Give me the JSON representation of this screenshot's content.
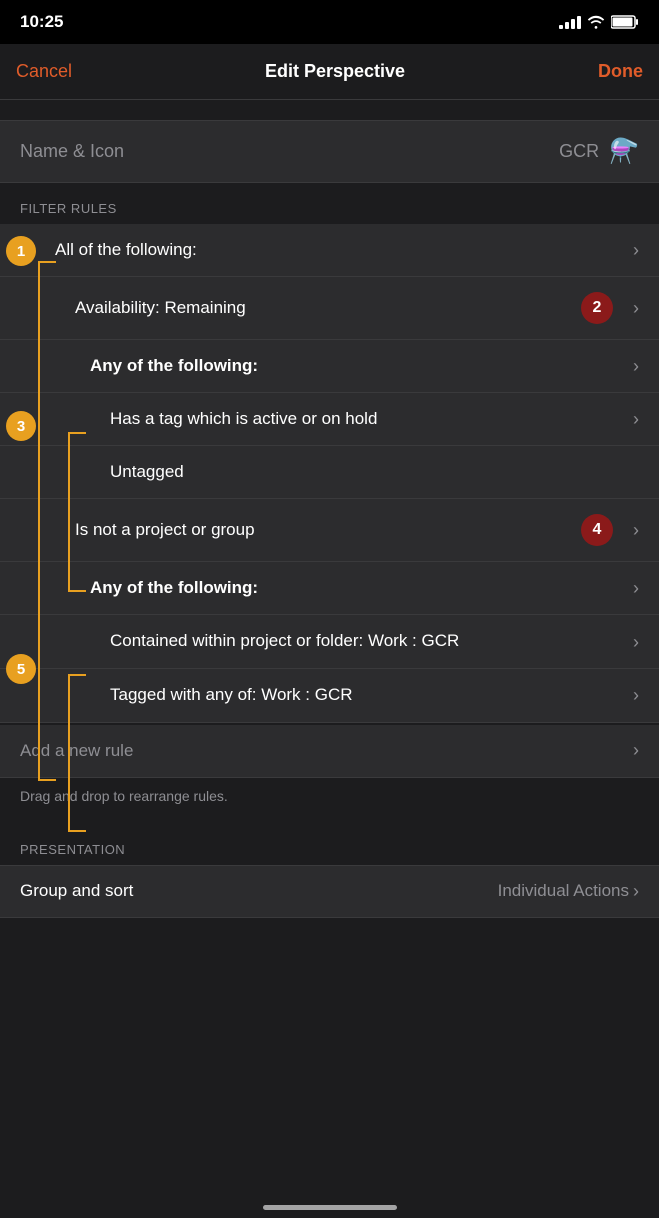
{
  "statusBar": {
    "time": "10:25",
    "timeIcon": "location-icon"
  },
  "navBar": {
    "cancelLabel": "Cancel",
    "title": "Edit Perspective",
    "doneLabel": "Done"
  },
  "nameSection": {
    "label": "Name & Icon",
    "value": "GCR",
    "iconLabel": "flask-icon"
  },
  "filterSection": {
    "header": "FILTER RULES",
    "rules": [
      {
        "id": "rule-1",
        "text": "All of the following:",
        "indent": 0,
        "bold": false,
        "hasChevron": true,
        "badge": null,
        "annotation": "1"
      },
      {
        "id": "rule-2",
        "text": "Availability: Remaining",
        "indent": 1,
        "bold": false,
        "hasChevron": true,
        "badge": "2",
        "annotation": null
      },
      {
        "id": "rule-3",
        "text": "Any of the following:",
        "indent": 1,
        "bold": true,
        "hasChevron": true,
        "badge": null,
        "annotation": null
      },
      {
        "id": "rule-4",
        "text": "Has a tag which is active or on hold",
        "indent": 2,
        "bold": false,
        "hasChevron": true,
        "badge": null,
        "annotation": null
      },
      {
        "id": "rule-5",
        "text": "Untagged",
        "indent": 2,
        "bold": false,
        "hasChevron": false,
        "badge": null,
        "annotation": null
      },
      {
        "id": "rule-6",
        "text": "Is not a project or group",
        "indent": 1,
        "bold": false,
        "hasChevron": true,
        "badge": "4",
        "annotation": null
      },
      {
        "id": "rule-7",
        "text": "Any of the following:",
        "indent": 1,
        "bold": true,
        "hasChevron": true,
        "badge": null,
        "annotation": null
      },
      {
        "id": "rule-8",
        "text": "Contained within project or folder: Work : GCR",
        "indent": 2,
        "bold": false,
        "hasChevron": true,
        "badge": null,
        "annotation": null
      },
      {
        "id": "rule-9",
        "text": "Tagged with any of: Work : GCR",
        "indent": 2,
        "bold": false,
        "hasChevron": true,
        "badge": null,
        "annotation": null
      }
    ],
    "addRuleLabel": "Add a new rule",
    "dragHint": "Drag and drop to rearrange rules."
  },
  "presentationSection": {
    "header": "PRESENTATION",
    "groupSortLabel": "Group and sort",
    "groupSortValue": "Individual Actions"
  },
  "annotations": [
    {
      "id": "ann-1",
      "number": "1"
    },
    {
      "id": "ann-3",
      "number": "3"
    },
    {
      "id": "ann-5",
      "number": "5"
    }
  ]
}
